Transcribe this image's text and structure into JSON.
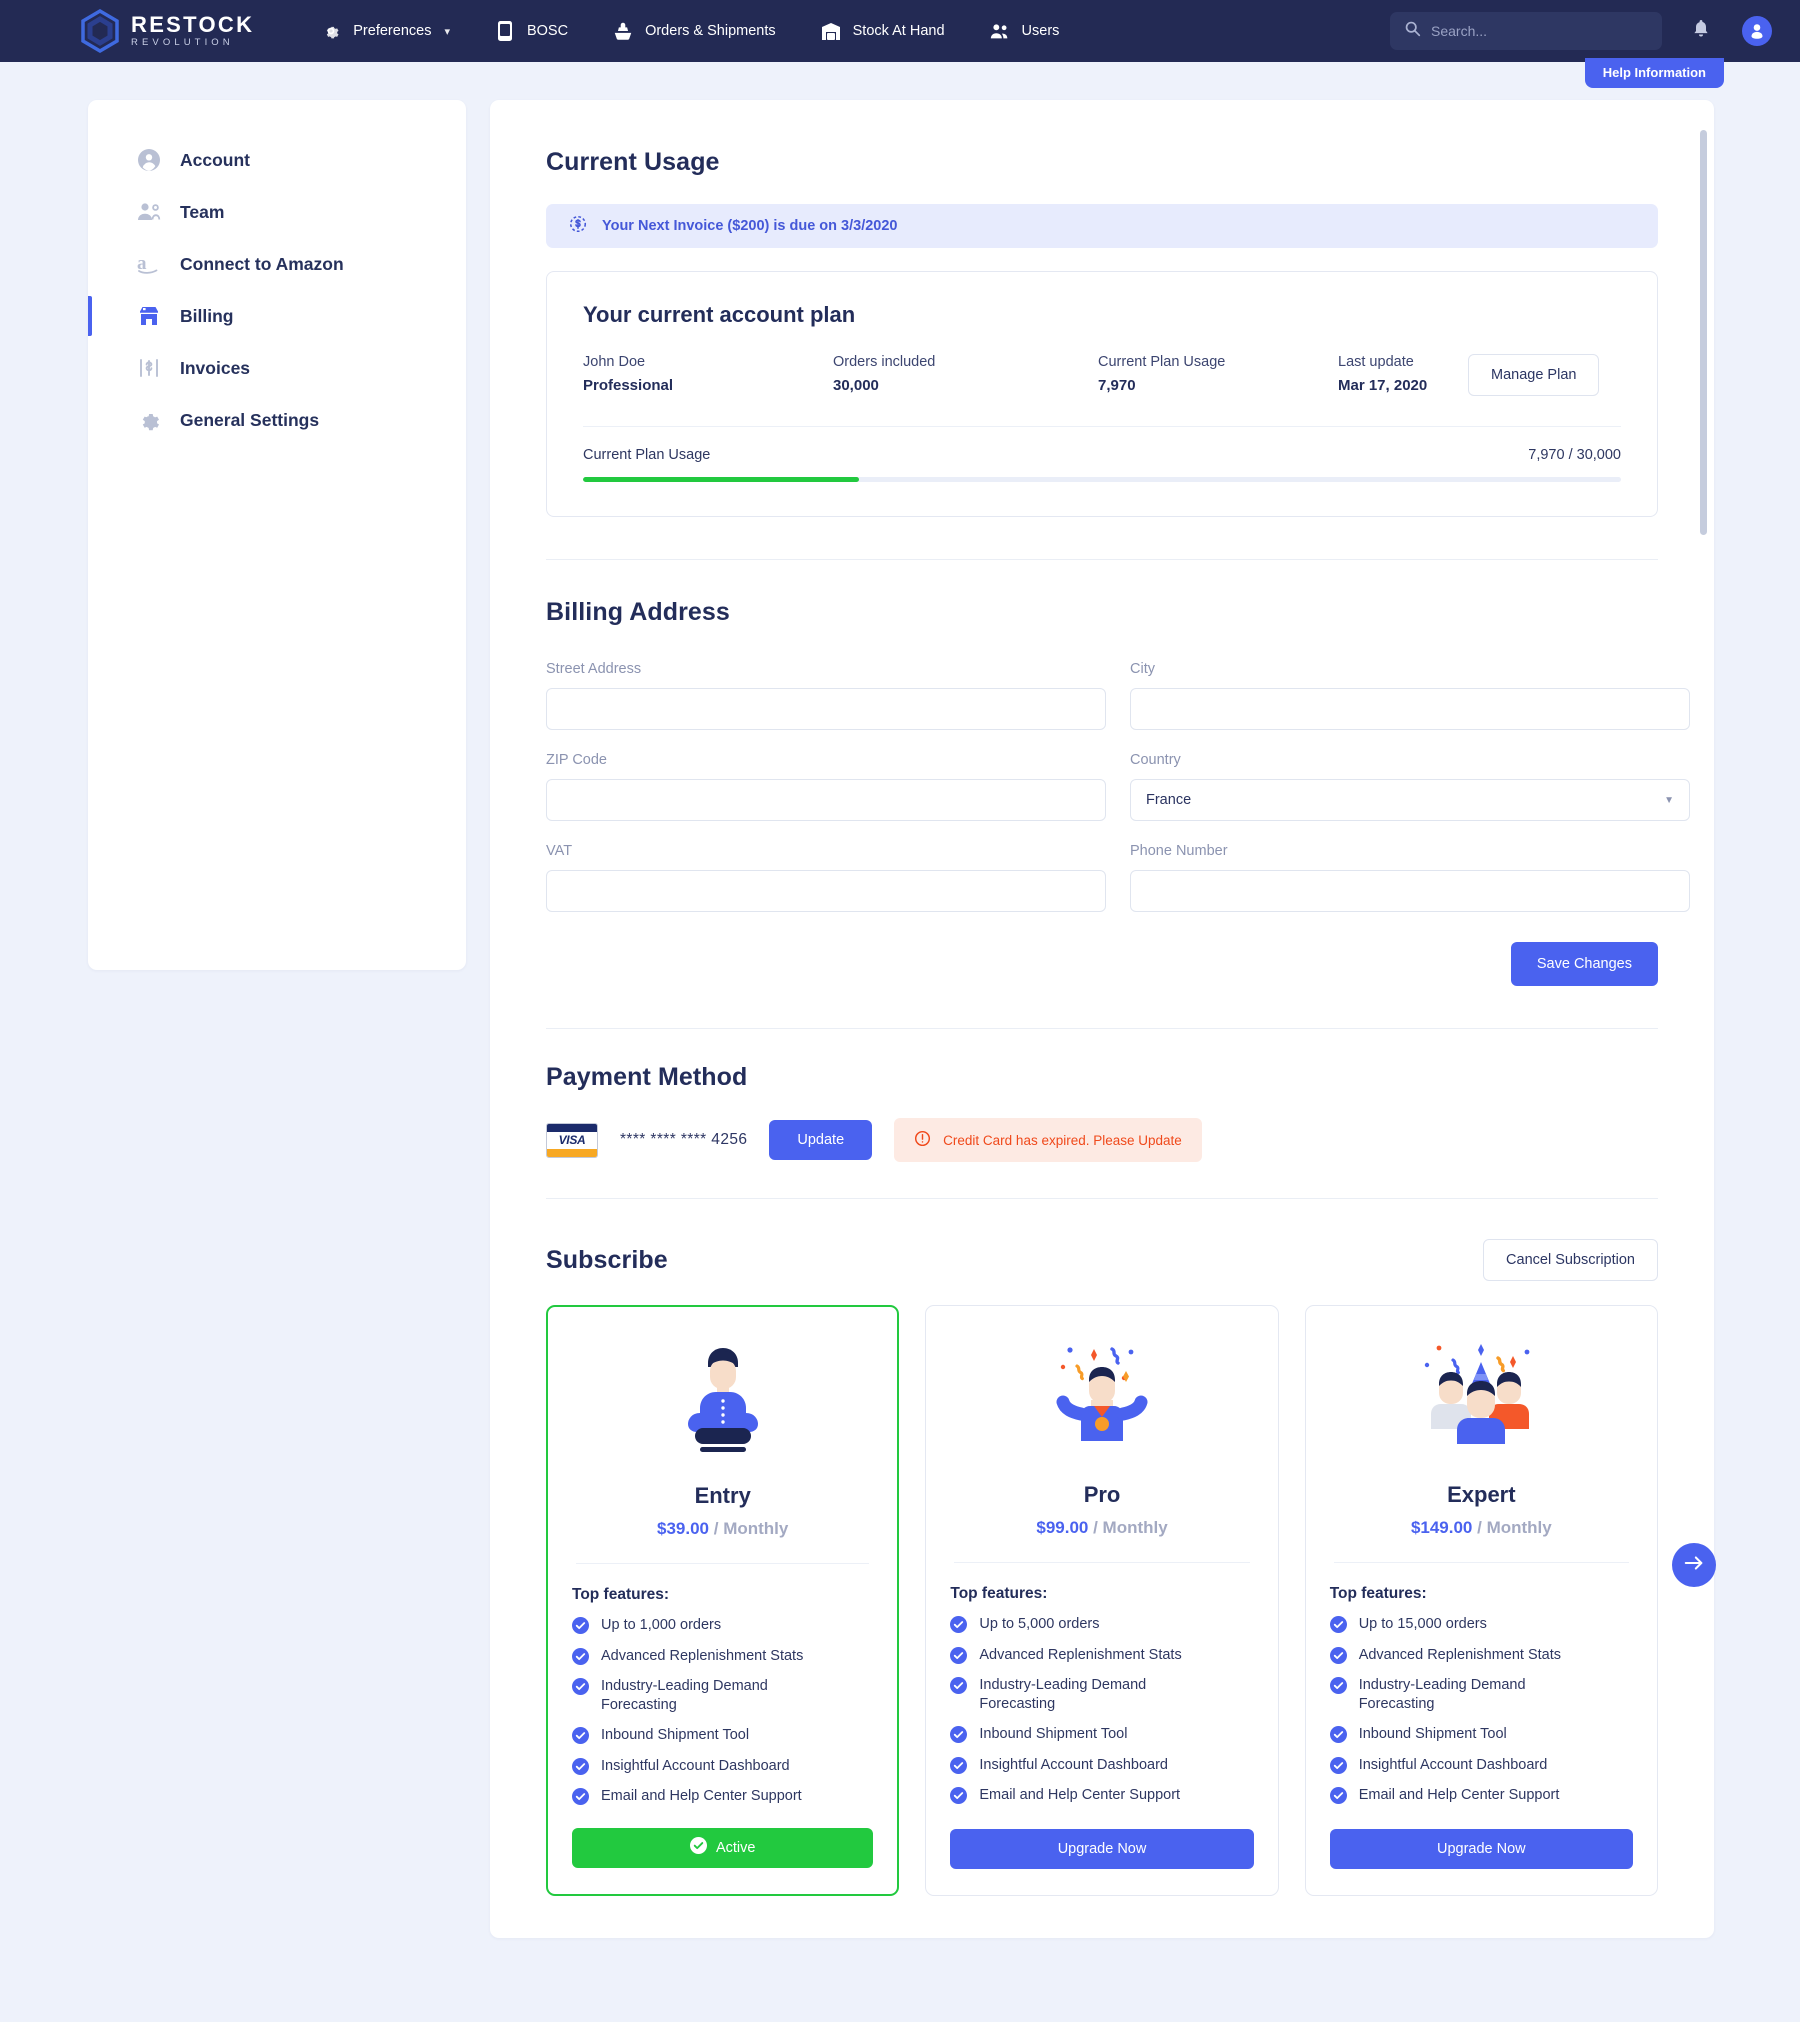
{
  "brand": {
    "line1": "RESTOCK",
    "line2": "REVOLUTION"
  },
  "topnav": {
    "items": [
      {
        "label": "Preferences",
        "icon": "gear-icon",
        "has_caret": true
      },
      {
        "label": "BOSC",
        "icon": "device-icon",
        "has_caret": false
      },
      {
        "label": "Orders & Shipments",
        "icon": "ship-icon",
        "has_caret": false
      },
      {
        "label": "Stock At Hand",
        "icon": "warehouse-icon",
        "has_caret": false
      },
      {
        "label": "Users",
        "icon": "users-icon",
        "has_caret": false
      }
    ],
    "search_placeholder": "Search...",
    "help_pill": "Help Information"
  },
  "sidebar": {
    "items": [
      {
        "label": "Account",
        "icon": "account-circle-icon",
        "active": false
      },
      {
        "label": "Team",
        "icon": "team-icon",
        "active": false
      },
      {
        "label": "Connect to Amazon",
        "icon": "amazon-icon",
        "active": false
      },
      {
        "label": "Billing",
        "icon": "store-icon",
        "active": true
      },
      {
        "label": "Invoices",
        "icon": "invoice-icon",
        "active": false
      },
      {
        "label": "General Settings",
        "icon": "settings-gear-icon",
        "active": false
      }
    ]
  },
  "current_usage": {
    "title": "Current Usage",
    "banner": "Your Next Invoice ($200) is due on 3/3/2020",
    "plan_card": {
      "heading": "Your current account plan",
      "user_name": "John Doe",
      "user_plan": "Professional",
      "orders_included_label": "Orders included",
      "orders_included_value": "30,000",
      "current_usage_label": "Current Plan Usage",
      "current_usage_value": "7,970",
      "last_update_label": "Last update",
      "last_update_value": "Mar 17, 2020",
      "manage_plan": "Manage Plan",
      "usage_bar_label": "Current Plan Usage",
      "usage_bar_value": "7,970 / 30,000",
      "usage_percent": 26.6,
      "usage_bar_color": "#22c93f"
    }
  },
  "billing_address": {
    "title": "Billing Address",
    "fields": [
      {
        "label": "Street Address",
        "value": "",
        "type": "text"
      },
      {
        "label": "City",
        "value": "",
        "type": "text"
      },
      {
        "label": "ZIP Code",
        "value": "",
        "type": "text"
      },
      {
        "label": "Country",
        "value": "France",
        "type": "select"
      },
      {
        "label": "VAT",
        "value": "",
        "type": "text"
      },
      {
        "label": "Phone Number",
        "value": "",
        "type": "text"
      }
    ],
    "save_label": "Save Changes"
  },
  "payment_method": {
    "title": "Payment Method",
    "card_brand": "VISA",
    "card_number": "**** **** **** 4256",
    "update_label": "Update",
    "alert_text": "Credit Card has expired. Please Update",
    "alert_color": "#f0491b"
  },
  "subscribe": {
    "title": "Subscribe",
    "cancel_label": "Cancel Subscription",
    "features_heading": "Top features:",
    "plans": [
      {
        "name": "Entry",
        "price": "$39.00",
        "period": "/ Monthly",
        "illustration": "meditating-person-illustration",
        "selected": true,
        "cta_label": "Active",
        "cta_type": "active",
        "features": [
          "Up to 1,000 orders",
          "Advanced Replenishment Stats",
          "Industry-Leading Demand Forecasting",
          "Inbound Shipment Tool",
          "Insightful Account Dashboard",
          "Email and Help Center Support"
        ]
      },
      {
        "name": "Pro",
        "price": "$99.00",
        "period": "/ Monthly",
        "illustration": "celebrating-medalist-illustration",
        "selected": false,
        "cta_label": "Upgrade Now",
        "cta_type": "upgrade",
        "features": [
          "Up to 5,000 orders",
          "Advanced Replenishment Stats",
          "Industry-Leading Demand Forecasting",
          "Inbound Shipment Tool",
          "Insightful Account Dashboard",
          "Email and Help Center Support"
        ]
      },
      {
        "name": "Expert",
        "price": "$149.00",
        "period": "/ Monthly",
        "illustration": "party-group-illustration",
        "selected": false,
        "cta_label": "Upgrade Now",
        "cta_type": "upgrade",
        "features": [
          "Up to 15,000 orders",
          "Advanced Replenishment Stats",
          "Industry-Leading Demand Forecasting",
          "Inbound Shipment Tool",
          "Insightful Account Dashboard",
          "Email and Help Center Support"
        ]
      }
    ]
  },
  "colors": {
    "accent": "#4a62ef",
    "success": "#22c93f",
    "navy": "#232a54",
    "danger": "#f0491b"
  }
}
